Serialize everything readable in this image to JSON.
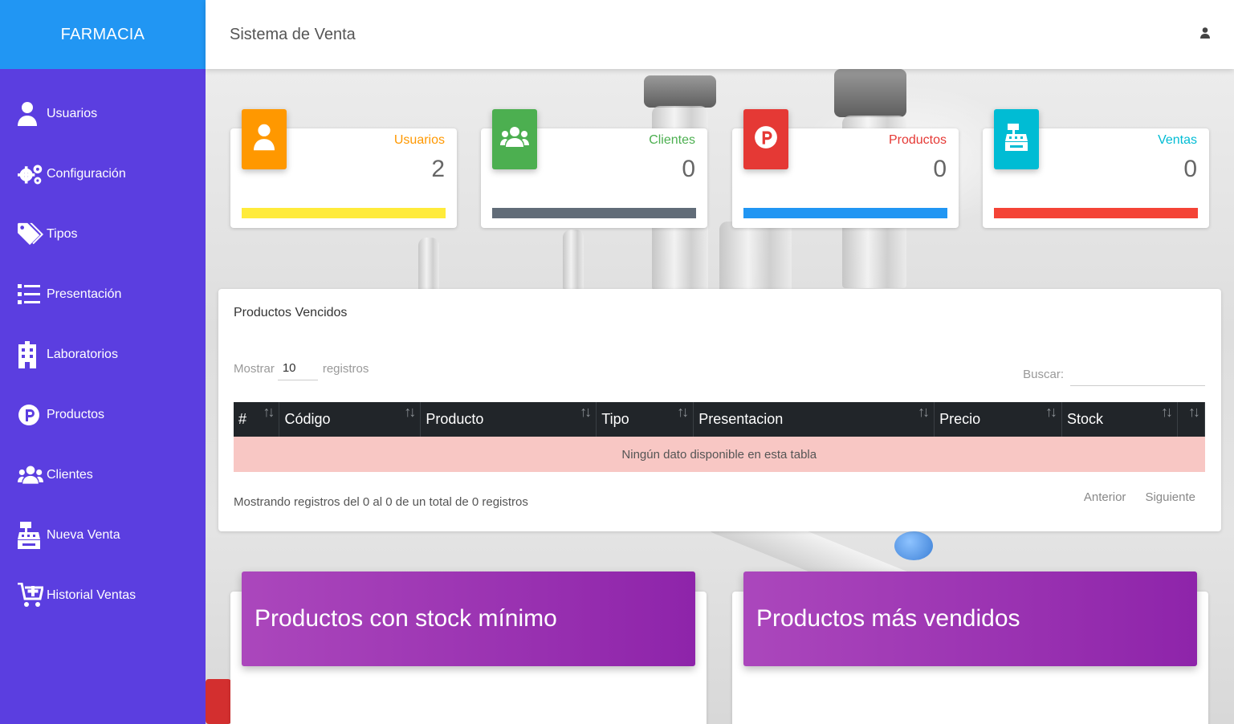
{
  "brand": "FARMACIA",
  "header": {
    "title": "Sistema de Venta",
    "user_icon": "user-icon"
  },
  "sidebar": {
    "items": [
      {
        "label": "Usuarios",
        "icon": "user-icon"
      },
      {
        "label": "Configuración",
        "icon": "gears-icon"
      },
      {
        "label": "Tipos",
        "icon": "tags-icon"
      },
      {
        "label": "Presentación",
        "icon": "list-icon"
      },
      {
        "label": "Laboratorios",
        "icon": "building-icon"
      },
      {
        "label": "Productos",
        "icon": "product-p-icon"
      },
      {
        "label": "Clientes",
        "icon": "users-icon"
      },
      {
        "label": "Nueva Venta",
        "icon": "cash-register-icon"
      },
      {
        "label": "Historial Ventas",
        "icon": "cart-plus-icon"
      }
    ]
  },
  "stats": [
    {
      "label": "Usuarios",
      "value": "2",
      "icon": "user-icon",
      "color": "#ff9800",
      "bar_color": "#ffeb3b"
    },
    {
      "label": "Clientes",
      "value": "0",
      "icon": "users-icon",
      "color": "#4caf50",
      "bar_color": "#616c78"
    },
    {
      "label": "Productos",
      "value": "0",
      "icon": "product-p-icon",
      "color": "#e53935",
      "bar_color": "#2196f3"
    },
    {
      "label": "Ventas",
      "value": "0",
      "icon": "cash-register-icon",
      "color": "#00bcd4",
      "bar_color": "#f44336"
    }
  ],
  "expired": {
    "title": "Productos Vencidos",
    "length": {
      "prefix": "Mostrar",
      "value": "10",
      "suffix": "registros"
    },
    "search_label": "Buscar:",
    "columns": [
      "#",
      "Código",
      "Producto",
      "Tipo",
      "Presentacion",
      "Precio",
      "Stock"
    ],
    "empty_message": "Ningún dato disponible en esta tabla",
    "info": "Mostrando registros del 0 al 0 de un total de 0 registros",
    "prev": "Anterior",
    "next": "Siguiente"
  },
  "cards": {
    "min_stock_title": "Productos con stock mínimo",
    "top_selling_title": "Productos más vendidos"
  }
}
